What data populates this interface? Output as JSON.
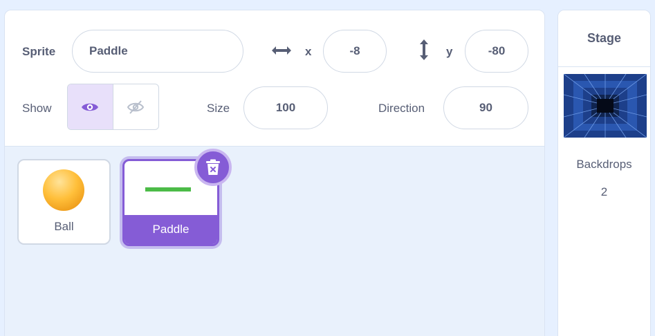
{
  "sprite_info": {
    "sprite_label": "Sprite",
    "sprite_name": "Paddle",
    "x_label": "x",
    "x_value": "-8",
    "y_label": "y",
    "y_value": "-80",
    "show_label": "Show",
    "size_label": "Size",
    "size_value": "100",
    "direction_label": "Direction",
    "direction_value": "90"
  },
  "sprites": [
    {
      "label": "Ball"
    },
    {
      "label": "Paddle",
      "selected": true
    }
  ],
  "stage": {
    "title": "Stage",
    "backdrops_label": "Backdrops",
    "backdrops_count": "2"
  },
  "colors": {
    "accent": "#855cd6",
    "paddle_green": "#4cbb47",
    "ball": "#ffbf3a"
  },
  "icons": [
    "eye-icon",
    "eye-off-icon",
    "horizontal-arrows-icon",
    "vertical-arrows-icon",
    "trash-icon"
  ]
}
